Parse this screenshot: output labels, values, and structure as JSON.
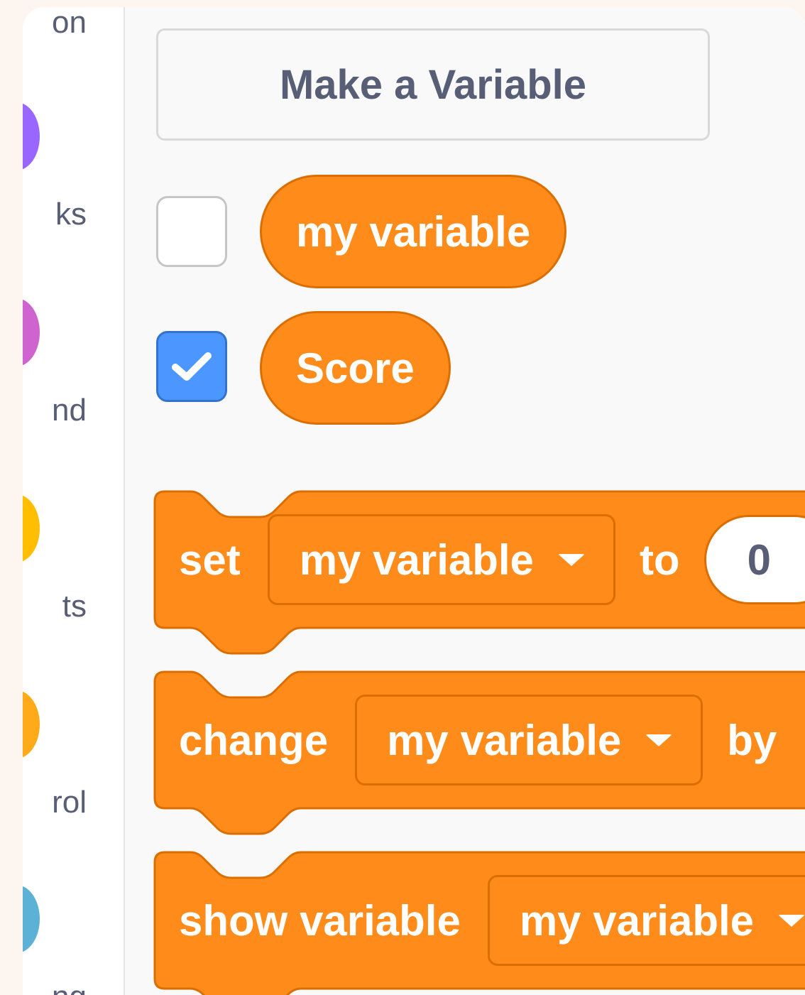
{
  "sidebar": {
    "categories": [
      {
        "label": "on",
        "color": ""
      },
      {
        "label": "ks",
        "color": "#9966ff"
      },
      {
        "label": "nd",
        "color": "#cf63cf"
      },
      {
        "label": "ts",
        "color": "#ffbf00"
      },
      {
        "label": "rol",
        "color": "#ffab19"
      },
      {
        "label": "ng",
        "color": "#5cb1d6"
      }
    ]
  },
  "palette": {
    "make_variable_label": "Make a Variable",
    "variables": [
      {
        "name": "my variable",
        "checked": false
      },
      {
        "name": "Score",
        "checked": true
      }
    ],
    "blocks": {
      "set": {
        "keyword": "set",
        "dropdown": "my variable",
        "joiner": "to",
        "value": "0"
      },
      "change": {
        "keyword": "change",
        "dropdown": "my variable",
        "joiner": "by"
      },
      "show": {
        "keyword": "show variable",
        "dropdown": "my variable"
      }
    },
    "colors": {
      "variables_block": "#ff8c1a",
      "variables_block_border": "#db6e00",
      "checkbox_checked": "#4c97ff"
    }
  }
}
